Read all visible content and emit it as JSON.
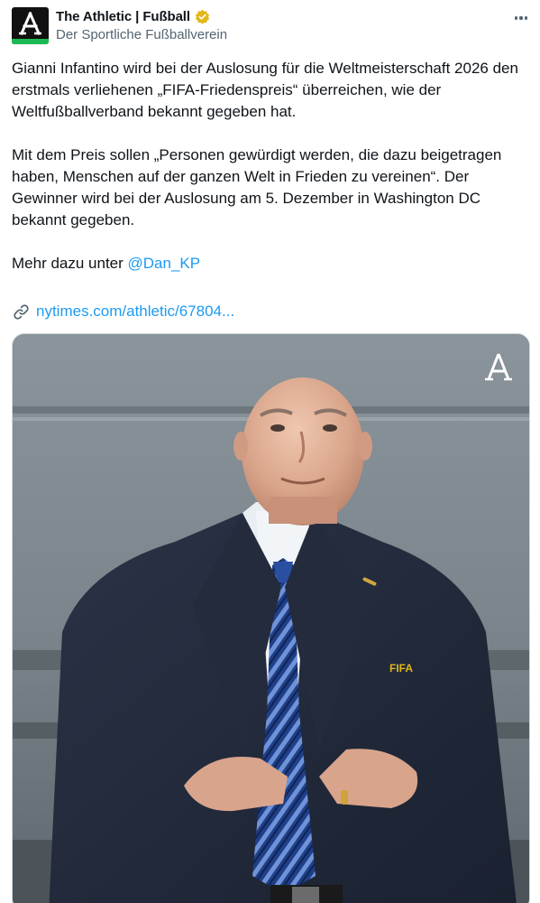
{
  "tweet": {
    "display_name": "The Athletic | Fußball",
    "handle": "Der Sportliche Fußballverein",
    "verified_icon": "verified-badge-icon",
    "avatar_letter": "A",
    "colors": {
      "accent_link": "#1d9bf0",
      "verified_gold": "#e2b719",
      "avatar_bar": "#1db954"
    },
    "paragraphs": [
      "Gianni Infantino wird bei der Auslosung für die Weltmeisterschaft 2026 den erstmals verliehenen „FIFA-Friedenspreis“ überreichen, wie der Weltfußballverband bekannt gegeben hat.",
      "Mit dem Preis sollen „Personen gewürdigt werden, die dazu beigetragen haben, Menschen auf der ganzen Welt in Frieden zu vereinen“. Der Gewinner wird bei der Auslosung am 5. Dezember in Washington DC bekannt gegeben."
    ],
    "more_prefix": "Mehr dazu unter ",
    "mention": "@Dan_KP",
    "link_text": "nytimes.com/athletic/67804...",
    "link_icon": "link-icon",
    "media": {
      "watermark_icon": "athletic-logo-icon",
      "badge_text": "FIFA"
    }
  }
}
